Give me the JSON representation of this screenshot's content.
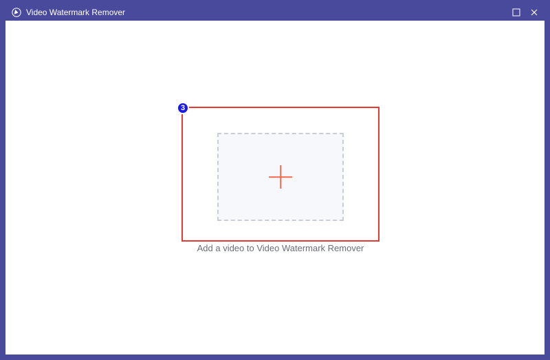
{
  "window": {
    "title": "Video Watermark Remover"
  },
  "highlight": {
    "step_number": "3"
  },
  "dropzone": {
    "caption": "Add a video to Video Watermark Remover"
  }
}
